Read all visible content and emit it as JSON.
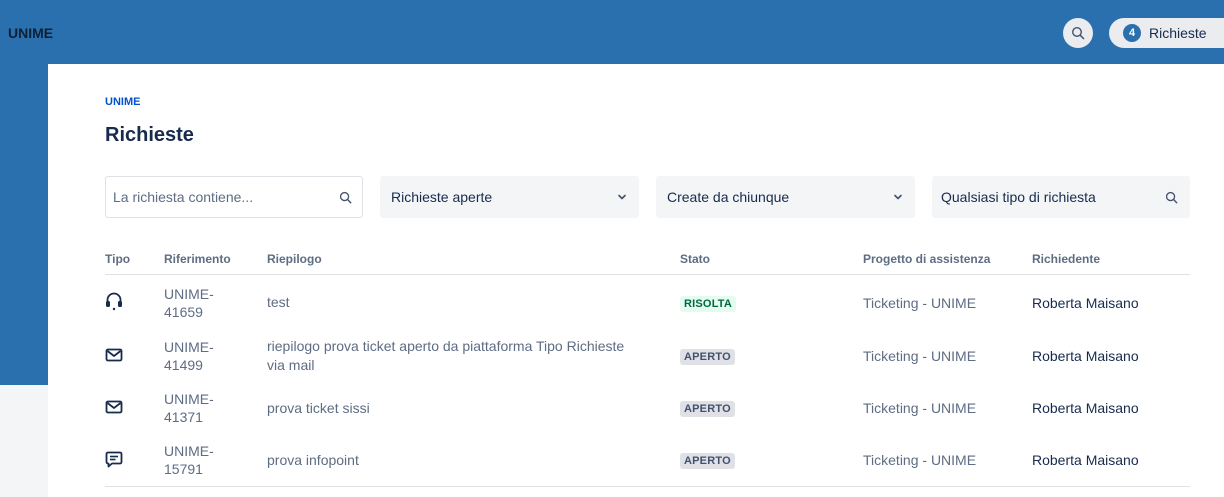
{
  "header": {
    "brand": "UNIME",
    "search_icon": "search-icon",
    "requests_count": "4",
    "requests_label": "Richieste"
  },
  "page": {
    "breadcrumb": "UNIME",
    "title": "Richieste"
  },
  "filters": {
    "search_placeholder": "La richiesta contiene...",
    "status": "Richieste aperte",
    "created_by": "Create da chiunque",
    "request_type": "Qualsiasi tipo di richiesta"
  },
  "table": {
    "headers": [
      "Tipo",
      "Riferimento",
      "Riepilogo",
      "Stato",
      "Progetto di assistenza",
      "Richiedente"
    ],
    "rows": [
      {
        "type_icon": "headset-icon",
        "ref": "UNIME-41659",
        "summary": "test",
        "status": "RISOLTA",
        "project": "Ticketing - UNIME",
        "requester": "Roberta Maisano"
      },
      {
        "type_icon": "mail-icon",
        "ref": "UNIME-41499",
        "summary": "riepilogo prova ticket aperto da piattaforma Tipo Richieste via mail",
        "status": "APERTO",
        "project": "Ticketing - UNIME",
        "requester": "Roberta Maisano"
      },
      {
        "type_icon": "mail-icon",
        "ref": "UNIME-41371",
        "summary": "prova ticket sissi",
        "status": "APERTO",
        "project": "Ticketing - UNIME",
        "requester": "Roberta Maisano"
      },
      {
        "type_icon": "chat-icon",
        "ref": "UNIME-15791",
        "summary": "prova infopoint",
        "status": "APERTO",
        "project": "Ticketing - UNIME",
        "requester": "Roberta Maisano"
      }
    ]
  },
  "colors": {
    "brand_blue": "#2a6fae",
    "resolved_bg": "#e3fcef",
    "resolved_text": "#006644",
    "open_bg": "#dfe1e6"
  }
}
